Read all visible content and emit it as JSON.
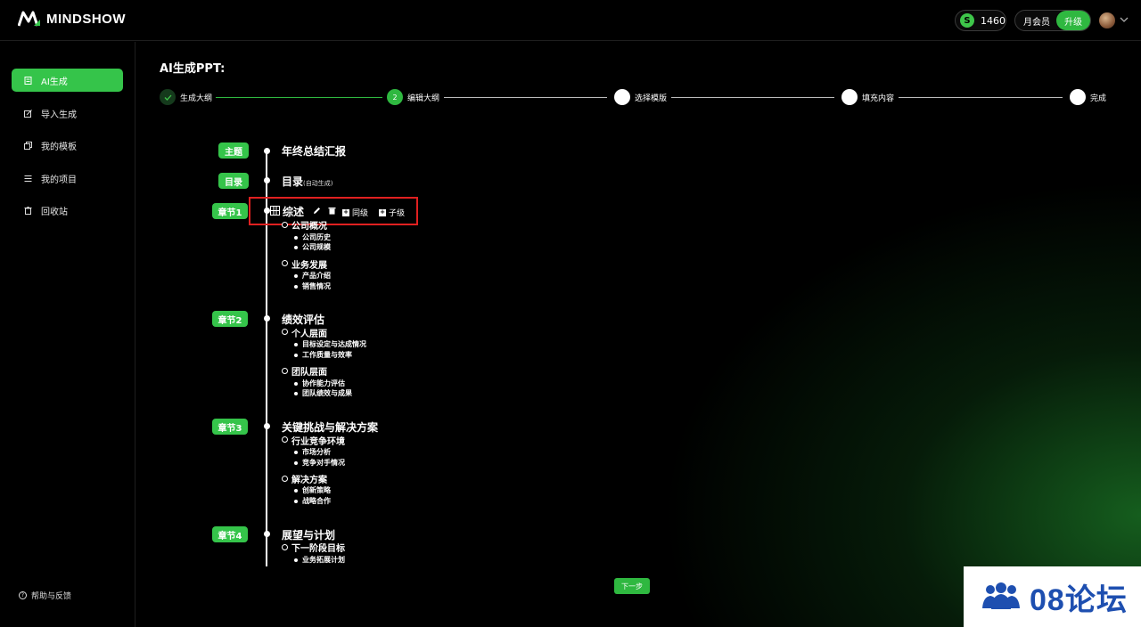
{
  "header": {
    "logo_text": "MINDSHOW",
    "credits": "1460",
    "membership_label": "月会员",
    "upgrade_label": "升级"
  },
  "sidebar": {
    "items": [
      {
        "label": "AI生成",
        "icon": "document-icon",
        "active": true
      },
      {
        "label": "导入生成",
        "icon": "edit-import-icon",
        "active": false
      },
      {
        "label": "我的模板",
        "icon": "copy-icon",
        "active": false
      },
      {
        "label": "我的项目",
        "icon": "list-icon",
        "active": false
      },
      {
        "label": "回收站",
        "icon": "trash-icon",
        "active": false
      }
    ],
    "help_label": "帮助与反馈"
  },
  "main": {
    "title": "AI生成PPT:",
    "steps": [
      {
        "label": "生成大纲",
        "state": "done"
      },
      {
        "label": "编辑大纲",
        "state": "current",
        "number": "2"
      },
      {
        "label": "选择模版",
        "state": "todo"
      },
      {
        "label": "填充内容",
        "state": "todo"
      },
      {
        "label": "完成",
        "state": "todo"
      }
    ],
    "toolbar": {
      "sibling_label": "同级",
      "child_label": "子级"
    },
    "next_label": "下一步"
  },
  "outline": {
    "theme": {
      "tag": "主题",
      "title": "年终总结汇报"
    },
    "toc": {
      "tag": "目录",
      "title": "目录",
      "note": "(自动生成)"
    },
    "chapters": [
      {
        "tag": "章节1",
        "title": "综述",
        "sections": [
          {
            "title": "公司概况",
            "items": [
              "公司历史",
              "公司规模"
            ]
          },
          {
            "title": "业务发展",
            "items": [
              "产品介绍",
              "销售情况"
            ]
          }
        ]
      },
      {
        "tag": "章节2",
        "title": "绩效评估",
        "sections": [
          {
            "title": "个人层面",
            "items": [
              "目标设定与达成情况",
              "工作质量与效率"
            ]
          },
          {
            "title": "团队层面",
            "items": [
              "协作能力评估",
              "团队绩效与成果"
            ]
          }
        ]
      },
      {
        "tag": "章节3",
        "title": "关键挑战与解决方案",
        "sections": [
          {
            "title": "行业竞争环境",
            "items": [
              "市场分析",
              "竞争对手情况"
            ]
          },
          {
            "title": "解决方案",
            "items": [
              "创新策略",
              "战略合作"
            ]
          }
        ]
      },
      {
        "tag": "章节4",
        "title": "展望与计划",
        "sections": [
          {
            "title": "下一阶段目标",
            "items": [
              "业务拓展计划"
            ]
          }
        ]
      }
    ]
  },
  "watermark": {
    "text": "08论坛"
  },
  "colors": {
    "accent": "#35c44a",
    "highlight_border": "#e02020",
    "background": "#000000"
  }
}
